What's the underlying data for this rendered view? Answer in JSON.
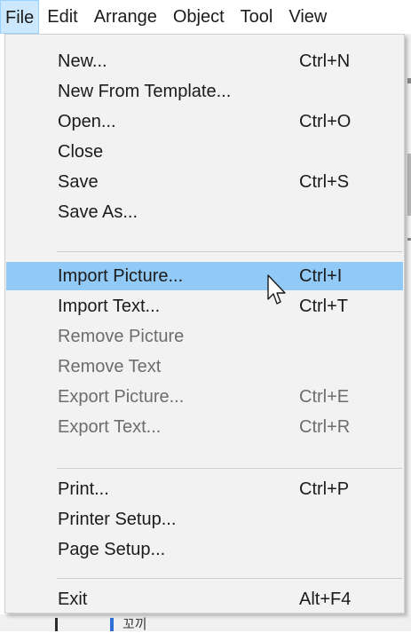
{
  "menubar": {
    "items": [
      {
        "label": "File"
      },
      {
        "label": "Edit"
      },
      {
        "label": "Arrange"
      },
      {
        "label": "Object"
      },
      {
        "label": "Tool"
      },
      {
        "label": "View"
      }
    ]
  },
  "file_menu": {
    "items": [
      {
        "label": "New...",
        "shortcut": "Ctrl+N",
        "enabled": true
      },
      {
        "label": "New From Template...",
        "shortcut": "",
        "enabled": true
      },
      {
        "label": "Open...",
        "shortcut": "Ctrl+O",
        "enabled": true
      },
      {
        "label": "Close",
        "shortcut": "",
        "enabled": true
      },
      {
        "label": "Save",
        "shortcut": "Ctrl+S",
        "enabled": true
      },
      {
        "label": "Save As...",
        "shortcut": "",
        "enabled": true
      },
      {
        "label": "Import Picture...",
        "shortcut": "Ctrl+I",
        "enabled": true,
        "highlighted": true
      },
      {
        "label": "Import Text...",
        "shortcut": "Ctrl+T",
        "enabled": true
      },
      {
        "label": "Remove Picture",
        "shortcut": "",
        "enabled": false
      },
      {
        "label": "Remove Text",
        "shortcut": "",
        "enabled": false
      },
      {
        "label": "Export Picture...",
        "shortcut": "Ctrl+E",
        "enabled": false
      },
      {
        "label": "Export Text...",
        "shortcut": "Ctrl+R",
        "enabled": false
      },
      {
        "label": "Print...",
        "shortcut": "Ctrl+P",
        "enabled": true
      },
      {
        "label": "Printer Setup...",
        "shortcut": "",
        "enabled": true
      },
      {
        "label": "Page Setup...",
        "shortcut": "",
        "enabled": true
      },
      {
        "label": "Exit",
        "shortcut": "Alt+F4",
        "enabled": true
      }
    ]
  },
  "background": {
    "fragment_text": "꼬끼"
  },
  "colors": {
    "menubar_active": "#cce8ff",
    "highlight": "#91c9f7",
    "disabled_text": "#6d6d6d",
    "menu_bg": "#f2f2f2"
  }
}
